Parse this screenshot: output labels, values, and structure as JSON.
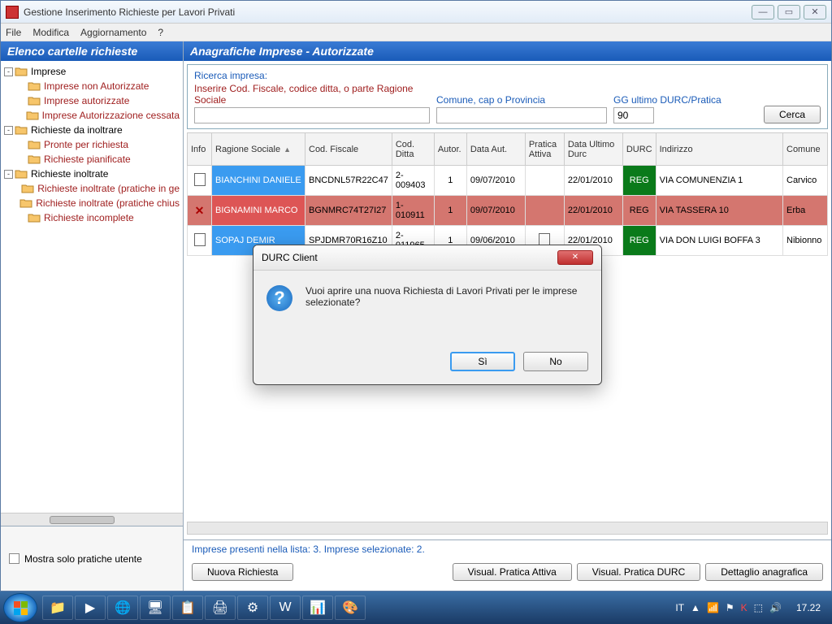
{
  "window": {
    "title": "Gestione Inserimento Richieste per Lavori Privati"
  },
  "menu": {
    "file": "File",
    "modifica": "Modifica",
    "aggiornamento": "Aggiornamento",
    "help": "?"
  },
  "left": {
    "header": "Elenco cartelle richieste",
    "tree": {
      "imprese": "Imprese",
      "imprese_non_aut": "Imprese non Autorizzate",
      "imprese_aut": "Imprese autorizzate",
      "imprese_aut_cessata": "Imprese Autorizzazione cessata",
      "rich_inoltrare": "Richieste da inoltrare",
      "pronte": "Pronte per richiesta",
      "pianificate": "Richieste pianificate",
      "rich_inoltrate": "Richieste inoltrate",
      "rich_inoltrate_ge": "Richieste inoltrate (pratiche in ge",
      "rich_inoltrate_chius": "Richieste inoltrate (pratiche chius",
      "rich_incomplete": "Richieste incomplete"
    },
    "checkbox": "Mostra solo pratiche utente"
  },
  "right": {
    "header": "Anagrafiche Imprese  - Autorizzate",
    "search": {
      "title": "Ricerca impresa:",
      "hint": "Inserire Cod. Fiscale,  codice ditta, o parte Ragione Sociale",
      "comune_lbl": "Comune, cap o Provincia",
      "gg_lbl": "GG ultimo DURC/Pratica",
      "gg_value": "90",
      "cerca": "Cerca"
    },
    "columns": {
      "info": "Info",
      "ragione": "Ragione Sociale",
      "cf": "Cod. Fiscale",
      "codditta": "Cod. Ditta",
      "autor": "Autor.",
      "dataaut": "Data Aut.",
      "pratica": "Pratica Attiva",
      "dataultimo": "Data Ultimo Durc",
      "durc": "DURC",
      "indirizzo": "Indirizzo",
      "comune": "Comune"
    },
    "rows": [
      {
        "icon": "doc",
        "ragione": "BIANCHINI DANIELE",
        "cf": "BNCDNL57R22C47",
        "codditta": "2-009403",
        "autor": "1",
        "dataaut": "09/07/2010",
        "pratica": "",
        "dataultimo": "22/01/2010",
        "durc": "REG",
        "indirizzo": "VIA COMUNENZIA 1",
        "comune": "Carvico"
      },
      {
        "icon": "x",
        "ragione": "BIGNAMINI MARCO",
        "cf": "BGNMRC74T27I27",
        "codditta": "1-010911",
        "autor": "1",
        "dataaut": "09/07/2010",
        "pratica": "",
        "dataultimo": "22/01/2010",
        "durc": "REG",
        "indirizzo": "VIA TASSERA 10",
        "comune": "Erba"
      },
      {
        "icon": "doc",
        "ragione": "SOPAJ DEMIR",
        "cf": "SPJDMR70R16Z10",
        "codditta": "2-011965",
        "autor": "1",
        "dataaut": "09/06/2010",
        "pratica": "doc",
        "dataultimo": "22/01/2010",
        "durc": "REG",
        "indirizzo": "VIA DON LUIGI BOFFA 3",
        "comune": "Nibionno"
      }
    ],
    "status": "Imprese presenti nella lista: 3. Imprese selezionate: 2.",
    "buttons": {
      "nuova": "Nuova Richiesta",
      "visual_pratica": "Visual. Pratica Attiva",
      "visual_durc": "Visual. Pratica DURC",
      "dettaglio": "Dettaglio anagrafica"
    }
  },
  "dialog": {
    "title": "DURC Client",
    "message": "Vuoi aprire una nuova Richiesta di Lavori Privati per le imprese selezionate?",
    "si": "Sì",
    "no": "No"
  },
  "taskbar": {
    "lang": "IT",
    "time": "17.22"
  }
}
